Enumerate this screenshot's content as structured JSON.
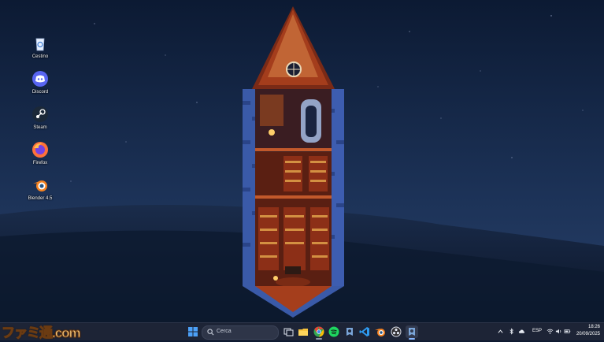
{
  "desktop": {
    "icons": [
      {
        "label": "Cestino",
        "icon": "recycle-bin-icon"
      },
      {
        "label": "Discord",
        "icon": "discord-icon"
      },
      {
        "label": "Steam",
        "icon": "steam-icon"
      },
      {
        "label": "Firefox",
        "icon": "firefox-icon"
      },
      {
        "label": "Blender 4.5",
        "icon": "blender-icon"
      }
    ]
  },
  "taskbar": {
    "search_label": "Cerca",
    "apps": [
      "task-view-icon",
      "file-explorer-icon",
      "chrome-icon",
      "spotify-icon",
      "game-icon",
      "vscode-icon",
      "blender-icon",
      "obs-icon",
      "active-app-icon"
    ],
    "active_app": "active-app-icon",
    "accent": "#86b6ff"
  },
  "tray": {
    "language": "ESP",
    "time": "18:26",
    "date": "20/09/2025",
    "icons": [
      "chevron-up-icon",
      "bluetooth-icon",
      "cloud-icon",
      "sync-icon",
      "wifi-icon",
      "volume-icon",
      "battery-icon"
    ]
  },
  "watermark": {
    "text": "ファミ通.com"
  },
  "colors": {
    "sky": "#1a2c4f",
    "hill": "#13223c",
    "taskbar": "#1d2436"
  }
}
